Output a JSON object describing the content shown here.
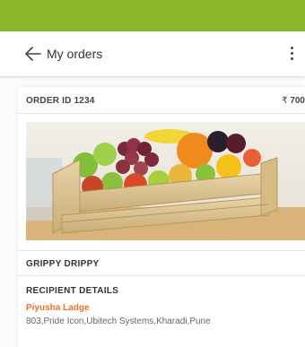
{
  "app_bar": {
    "title": "My orders",
    "back_icon": "arrow-left-icon",
    "menu_icon": "more-vertical-icon"
  },
  "order": {
    "id_label": "ORDER ID 1234",
    "currency": "₹",
    "amount": "700",
    "product_name": "GRIPPY DRIPPY",
    "product_image": "fruit-crate-image"
  },
  "recipient": {
    "heading": "RECIPIENT DETAILS",
    "name": "Piyusha Ladge",
    "address": "803,Pride Icon,Ubitech Systems,Kharadi,Pune"
  },
  "colors": {
    "status_bar": "#8bb52a",
    "accent": "#e8722c"
  }
}
